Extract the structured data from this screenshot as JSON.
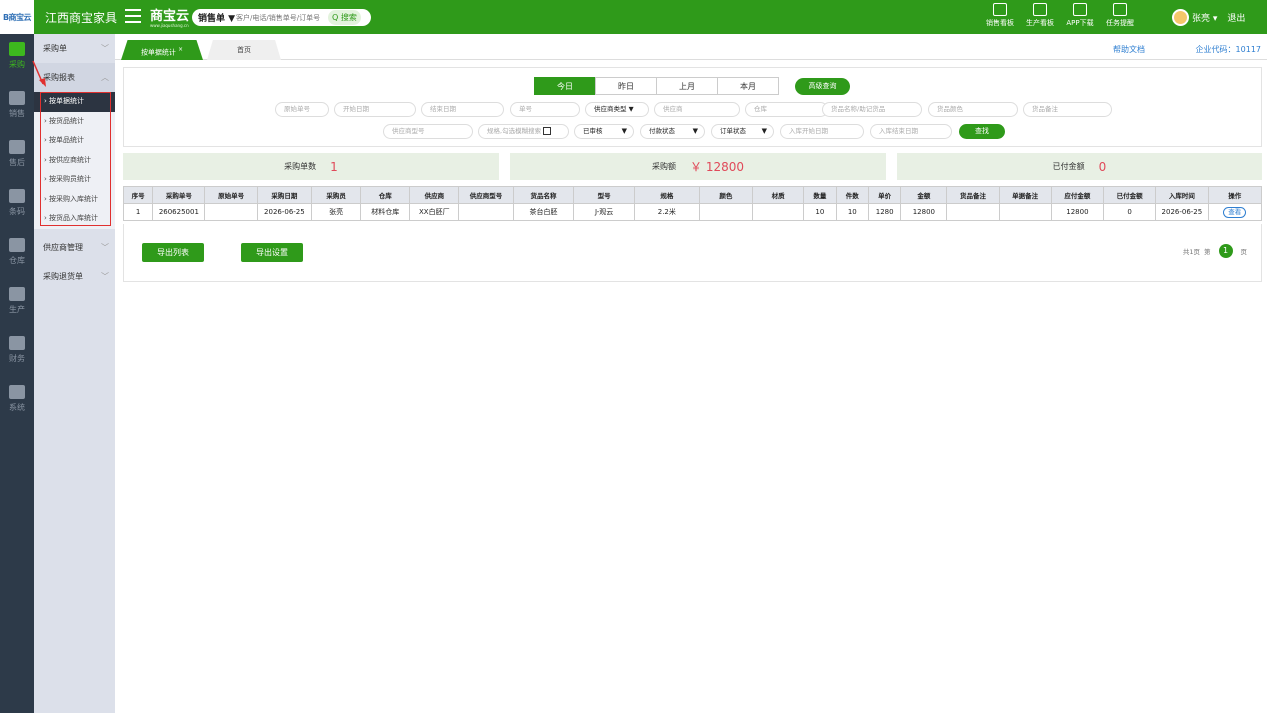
{
  "top": {
    "logo_text": "B商宝云",
    "company": "江西商宝家具",
    "brand": "商宝云",
    "brand_sub": "www.jiaqushang.cn",
    "search_type": "销售单 ▼",
    "search_placeholder": "客户/电话/销售单号/订单号",
    "search_button": "Q 搜索",
    "tools": [
      "销售看板",
      "生产看板",
      "APP下载",
      "任务提醒"
    ],
    "user_name": "张亮 ▾",
    "logout": "退出"
  },
  "rail": [
    "采购",
    "销售",
    "售后",
    "条码",
    "仓库",
    "生产",
    "财务",
    "系统"
  ],
  "side": {
    "groups": [
      {
        "label": "采购单",
        "chev": "﹀"
      },
      {
        "label": "采购报表",
        "chev": "︿"
      }
    ],
    "subs": [
      "按单据统计",
      "按货品统计",
      "按单品统计",
      "按供应商统计",
      "按采购员统计",
      "按采购入库统计",
      "按货品入库统计"
    ],
    "groups_after": [
      {
        "label": "供应商管理",
        "chev": "﹀"
      },
      {
        "label": "采购退货单",
        "chev": "﹀"
      }
    ]
  },
  "tabs": {
    "active": "按单据统计",
    "active_close": "×",
    "home": "首页"
  },
  "help": "帮助文档",
  "corp_code": "企业代码：10117",
  "filter": {
    "date_tabs": [
      "今日",
      "昨日",
      "上月",
      "本月"
    ],
    "advanced": "高级查询",
    "row1": [
      "原始单号",
      "开始日期",
      "结束日期",
      "单号",
      "供应商类型 ▼",
      "供应商",
      "仓库",
      "货品名称/助记货品",
      "货品颜色",
      "货品备注"
    ],
    "row2": [
      "供应商型号",
      "规格,勾选模糊搜索",
      "已审核",
      "付款状态",
      "订单状态",
      "入库开始日期",
      "入库结束日期"
    ],
    "search": "查找"
  },
  "summary": [
    {
      "label": "采购单数",
      "value": "1"
    },
    {
      "label": "采购额",
      "value": "￥ 12800"
    },
    {
      "label": "已付金额",
      "value": "0"
    }
  ],
  "table": {
    "headers": [
      "序号",
      "采购单号",
      "原始单号",
      "采购日期",
      "采购员",
      "仓库",
      "供应商",
      "供应商型号",
      "货品名称",
      "型号",
      "规格",
      "颜色",
      "材质",
      "数量",
      "件数",
      "单价",
      "金额",
      "货品备注",
      "单据备注",
      "应付金额",
      "已付金额",
      "入库时间",
      "操作"
    ],
    "rows": [
      [
        "1",
        "260625001",
        "",
        "2026-06-25",
        "张亮",
        "材料仓库",
        "XX白胚厂",
        "",
        "茶台白胚",
        "J-观云",
        "2.2米",
        "",
        "",
        "10",
        "10",
        "1280",
        "12800",
        "",
        "",
        "12800",
        "0",
        "2026-06-25",
        "查看"
      ]
    ]
  },
  "actions": {
    "export_list": "导出列表",
    "export_settings": "导出设置"
  },
  "pager": {
    "total": "共1页",
    "di": "第",
    "page": "1",
    "ye": "页"
  },
  "colors": {
    "brand_green": "#2f9a1a",
    "rail_bg": "#2d3a49",
    "highlight_red": "#e0302f",
    "value_pink": "#e04a5a"
  }
}
